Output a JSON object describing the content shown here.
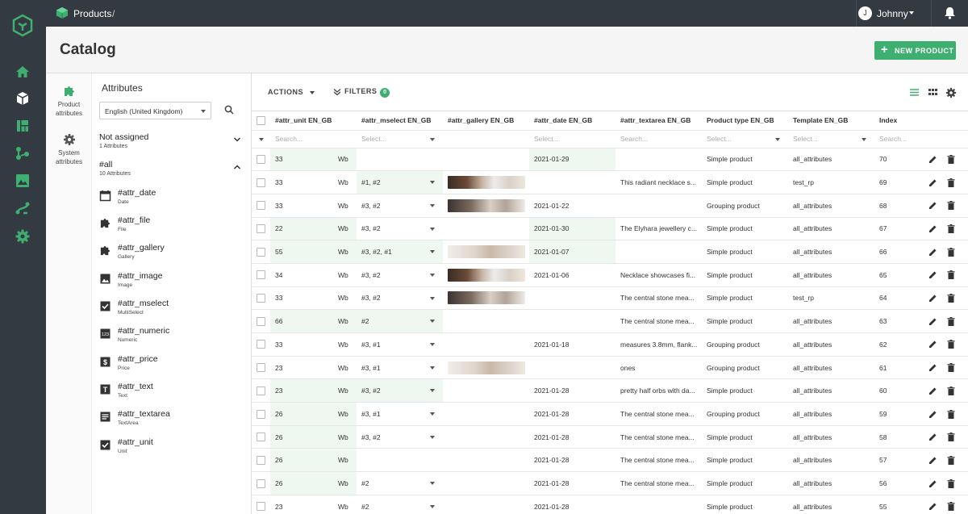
{
  "breadcrumb": {
    "section": "Products",
    "separator": "/"
  },
  "user": {
    "initial": "J",
    "name": "Johnny"
  },
  "page": {
    "title": "Catalog",
    "new_button": "NEW PRODUCT"
  },
  "side_tabs": [
    {
      "label": "Product attributes"
    },
    {
      "label": "System attributes"
    }
  ],
  "attributes_panel": {
    "title": "Attributes",
    "language": "English (United Kingdom)",
    "groups": [
      {
        "name": "Not assigned",
        "count": "1 Attributes"
      },
      {
        "name": "#all",
        "count": "10 Attributes"
      }
    ],
    "items": [
      {
        "name": "#attr_date",
        "type": "Date",
        "icon": "calendar-icon"
      },
      {
        "name": "#attr_file",
        "type": "File",
        "icon": "puzzle-icon"
      },
      {
        "name": "#attr_gallery",
        "type": "Gallery",
        "icon": "puzzle-icon"
      },
      {
        "name": "#attr_image",
        "type": "Image",
        "icon": "image-icon"
      },
      {
        "name": "#attr_mselect",
        "type": "MultiSelect",
        "icon": "checkbox-icon"
      },
      {
        "name": "#attr_numeric",
        "type": "Numeric",
        "icon": "numeric-icon"
      },
      {
        "name": "#attr_price",
        "type": "Price",
        "icon": "dollar-icon"
      },
      {
        "name": "#attr_text",
        "type": "Text",
        "icon": "text-icon"
      },
      {
        "name": "#attr_textarea",
        "type": "TextArea",
        "icon": "textarea-icon"
      },
      {
        "name": "#attr_unit",
        "type": "Unit",
        "icon": "checkbox-icon"
      }
    ]
  },
  "toolbar": {
    "actions": "ACTIONS",
    "filters": "FILTERS",
    "filter_count": "0"
  },
  "columns": [
    "#attr_unit EN_GB",
    "#attr_mselect EN_GB",
    "#attr_gallery EN_GB",
    "#attr_date EN_GB",
    "#attr_textarea EN_GB",
    "Product type EN_GB",
    "Template EN_GB",
    "Index"
  ],
  "filters": {
    "search": "Search...",
    "select": "Select..."
  },
  "rows": [
    {
      "unit": "33",
      "unit_suffix": "Wb",
      "mselect": "",
      "gallery": "",
      "date": "2021-01-29",
      "textarea": "",
      "type": "Simple product",
      "template": "all_attributes",
      "index": "70"
    },
    {
      "unit": "33",
      "unit_suffix": "Wb",
      "mselect": "#1, #2",
      "gallery": "dark",
      "date": "",
      "textarea": "This radiant necklace s...",
      "type": "Simple product",
      "template": "test_rp",
      "index": "69"
    },
    {
      "unit": "33",
      "unit_suffix": "Wb",
      "mselect": "#3, #2",
      "gallery": "mix",
      "date": "2021-01-22",
      "textarea": "",
      "type": "Grouping product",
      "template": "all_attributes",
      "index": "68"
    },
    {
      "unit": "22",
      "unit_suffix": "Wb",
      "mselect": "#3, #2",
      "gallery": "",
      "date": "2021-01-30",
      "textarea": "The Elyhara jewellery c...",
      "type": "Simple product",
      "template": "all_attributes",
      "index": "67"
    },
    {
      "unit": "55",
      "unit_suffix": "Wb",
      "mselect": "#3, #2, #1",
      "gallery": "light",
      "date": "2021-01-07",
      "textarea": "",
      "type": "Simple product",
      "template": "all_attributes",
      "index": "66"
    },
    {
      "unit": "34",
      "unit_suffix": "Wb",
      "mselect": "#3, #2",
      "gallery": "dark",
      "date": "2021-01-06",
      "textarea": "Necklace showcases fi...",
      "type": "Simple product",
      "template": "all_attributes",
      "index": "65"
    },
    {
      "unit": "33",
      "unit_suffix": "Wb",
      "mselect": "#3, #2",
      "gallery": "mix",
      "date": "",
      "textarea": "The central stone mea...",
      "type": "Simple product",
      "template": "test_rp",
      "index": "64"
    },
    {
      "unit": "66",
      "unit_suffix": "Wb",
      "mselect": "#2",
      "gallery": "",
      "date": "",
      "textarea": "The central stone mea...",
      "type": "Simple product",
      "template": "all_attributes",
      "index": "63"
    },
    {
      "unit": "33",
      "unit_suffix": "Wb",
      "mselect": "#3, #1",
      "gallery": "",
      "date": "2021-01-18",
      "textarea": "measures 3.8mm, flank...",
      "type": "Grouping product",
      "template": "all_attributes",
      "index": "62"
    },
    {
      "unit": "23",
      "unit_suffix": "Wb",
      "mselect": "#3, #1",
      "gallery": "light",
      "date": "",
      "textarea": "ones",
      "type": "Grouping product",
      "template": "all_attributes",
      "index": "61"
    },
    {
      "unit": "23",
      "unit_suffix": "Wb",
      "mselect": "#3, #2",
      "gallery": "",
      "date": "2021-01-28",
      "textarea": "pretty half orbs with da...",
      "type": "Simple product",
      "template": "all_attributes",
      "index": "60"
    },
    {
      "unit": "26",
      "unit_suffix": "Wb",
      "mselect": "#3, #1",
      "gallery": "",
      "date": "2021-01-28",
      "textarea": "The central stone mea...",
      "type": "Grouping product",
      "template": "all_attributes",
      "index": "59"
    },
    {
      "unit": "26",
      "unit_suffix": "Wb",
      "mselect": "#3, #2",
      "gallery": "",
      "date": "2021-01-28",
      "textarea": "The central stone mea...",
      "type": "Simple product",
      "template": "all_attributes",
      "index": "58"
    },
    {
      "unit": "26",
      "unit_suffix": "Wb",
      "mselect": "",
      "gallery": "",
      "date": "2021-01-28",
      "textarea": "The central stone mea...",
      "type": "Simple product",
      "template": "all_attributes",
      "index": "57"
    },
    {
      "unit": "26",
      "unit_suffix": "Wb",
      "mselect": "#2",
      "gallery": "",
      "date": "2021-01-28",
      "textarea": "The central stone mea...",
      "type": "Simple product",
      "template": "all_attributes",
      "index": "56"
    },
    {
      "unit": "23",
      "unit_suffix": "Wb",
      "mselect": "#2",
      "gallery": "",
      "date": "2021-01-28",
      "textarea": "",
      "type": "Simple product",
      "template": "all_attributes",
      "index": "55"
    }
  ],
  "colors": {
    "accent": "#3eaf70",
    "topbar": "#343a41",
    "highlight": "#eef7f0"
  }
}
